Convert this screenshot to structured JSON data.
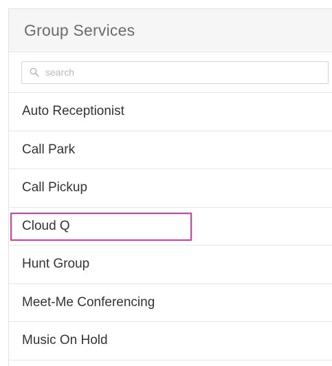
{
  "panel": {
    "title": "Group Services"
  },
  "search": {
    "placeholder": "search",
    "value": ""
  },
  "services": [
    {
      "label": "Auto Receptionist"
    },
    {
      "label": "Call Park"
    },
    {
      "label": "Call Pickup"
    },
    {
      "label": "Cloud Q",
      "highlighted": true
    },
    {
      "label": "Hunt Group"
    },
    {
      "label": "Meet-Me Conferencing"
    },
    {
      "label": "Music On Hold"
    }
  ],
  "colors": {
    "highlight": "#d63aa6",
    "header_bg": "#f6f6f6",
    "border": "#e6e6e6"
  },
  "icons": {
    "search": "search-icon"
  }
}
